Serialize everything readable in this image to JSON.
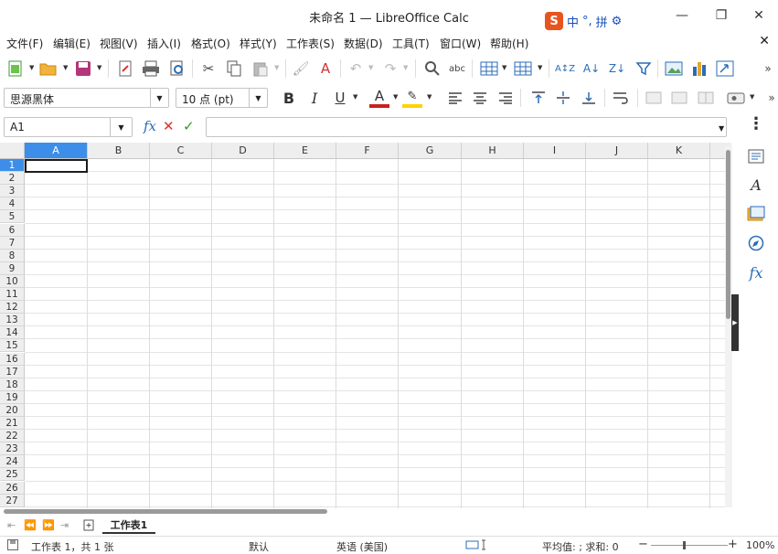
{
  "window": {
    "title": "未命名 1 — LibreOffice Calc",
    "ime": {
      "logo": "S",
      "labels": [
        "中",
        "°,",
        "拼",
        "⚙"
      ]
    },
    "controls": [
      "—",
      "❐",
      "✕"
    ]
  },
  "menu": {
    "items": [
      "文件(F)",
      "编辑(E)",
      "视图(V)",
      "插入(I)",
      "格式(O)",
      "样式(Y)",
      "工作表(S)",
      "数据(D)",
      "工具(T)",
      "窗口(W)",
      "帮助(H)"
    ],
    "close": "✕"
  },
  "format_toolbar": {
    "font_name": "思源黑体",
    "font_size": "10 点 (pt)"
  },
  "formula_bar": {
    "name_box": "A1",
    "formula": ""
  },
  "grid": {
    "columns": [
      "A",
      "B",
      "C",
      "D",
      "E",
      "F",
      "G",
      "H",
      "I",
      "J",
      "K"
    ],
    "rows": [
      "1",
      "2",
      "3",
      "4",
      "5",
      "6",
      "7",
      "8",
      "9",
      "10",
      "11",
      "12",
      "13",
      "14",
      "15",
      "16",
      "17",
      "18",
      "19",
      "20",
      "21",
      "22",
      "23",
      "24",
      "25",
      "26",
      "27"
    ],
    "selected_column": "A",
    "selected_row": "1"
  },
  "sheet_tabs": {
    "active": "工作表1"
  },
  "status": {
    "sheet_info": "工作表 1，共 1 张",
    "page_style": "默认",
    "language": "英语 (美国)",
    "calc_summary": "平均值: ; 求和: 0",
    "zoom": "100%"
  },
  "colors": {
    "selection": "#3d8ee8",
    "header_bg": "#eeeeee"
  }
}
